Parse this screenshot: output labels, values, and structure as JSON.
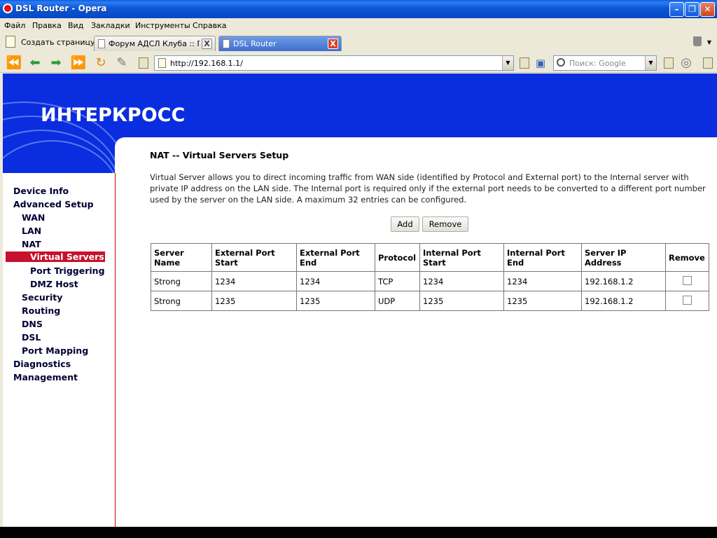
{
  "window": {
    "title": "DSL Router - Opera",
    "minimize_glyph": "–",
    "maximize_glyph": "❐",
    "close_glyph": "✕"
  },
  "menu": [
    "Файл",
    "Правка",
    "Вид",
    "Закладки",
    "Инструменты",
    "Справка"
  ],
  "tabs": {
    "new_page_label": "Создать страницу",
    "items": [
      {
        "label": "Форум АДСЛ Клуба :: П…",
        "active": false
      },
      {
        "label": "DSL Router",
        "active": true
      }
    ],
    "close_glyph": "X"
  },
  "address": {
    "url": "http://192.168.1.1/",
    "search_placeholder": "Поиск: Google",
    "dropdown_glyph": "▼"
  },
  "toolbar_glyphs": {
    "rewind": "⏪",
    "back": "⬅",
    "forward": "➡",
    "fastforward": "⏩",
    "reload": "↻",
    "edit": "✎",
    "view": "▣",
    "zoom": "◎"
  },
  "router": {
    "logo_text": "ИНТЕРКРОСС",
    "nav": [
      {
        "label": "Device Info",
        "level": 0,
        "selected": false
      },
      {
        "label": "Advanced Setup",
        "level": 0,
        "selected": false
      },
      {
        "label": "WAN",
        "level": 1,
        "selected": false
      },
      {
        "label": "LAN",
        "level": 1,
        "selected": false
      },
      {
        "label": "NAT",
        "level": 1,
        "selected": false
      },
      {
        "label": "Virtual Servers",
        "level": 2,
        "selected": true
      },
      {
        "label": "Port Triggering",
        "level": 2,
        "selected": false
      },
      {
        "label": "DMZ Host",
        "level": 2,
        "selected": false
      },
      {
        "label": "Security",
        "level": 1,
        "selected": false
      },
      {
        "label": "Routing",
        "level": 1,
        "selected": false
      },
      {
        "label": "DNS",
        "level": 1,
        "selected": false
      },
      {
        "label": "DSL",
        "level": 1,
        "selected": false
      },
      {
        "label": "Port Mapping",
        "level": 1,
        "selected": false
      },
      {
        "label": "Diagnostics",
        "level": 0,
        "selected": false
      },
      {
        "label": "Management",
        "level": 0,
        "selected": false
      }
    ],
    "page_title": "NAT -- Virtual Servers Setup",
    "description": "Virtual Server allows you to direct incoming traffic from WAN side (identified by Protocol and External port) to the Internal server with private IP address on the LAN side. The Internal port is required only if the external port needs to be converted to a different port number used by the server on the LAN side. A maximum 32 entries can be configured.",
    "buttons": {
      "add": "Add",
      "remove": "Remove"
    },
    "table": {
      "headers": [
        "Server Name",
        "External Port Start",
        "External Port End",
        "Protocol",
        "Internal Port Start",
        "Internal Port End",
        "Server IP Address",
        "Remove"
      ],
      "rows": [
        [
          "Strong",
          "1234",
          "1234",
          "TCP",
          "1234",
          "1234",
          "192.168.1.2"
        ],
        [
          "Strong",
          "1235",
          "1235",
          "UDP",
          "1235",
          "1235",
          "192.168.1.2"
        ]
      ]
    }
  },
  "colors": {
    "banner": "#0a2de0",
    "nav_selected": "#c8102e",
    "sidebar_border": "#cc0000"
  }
}
